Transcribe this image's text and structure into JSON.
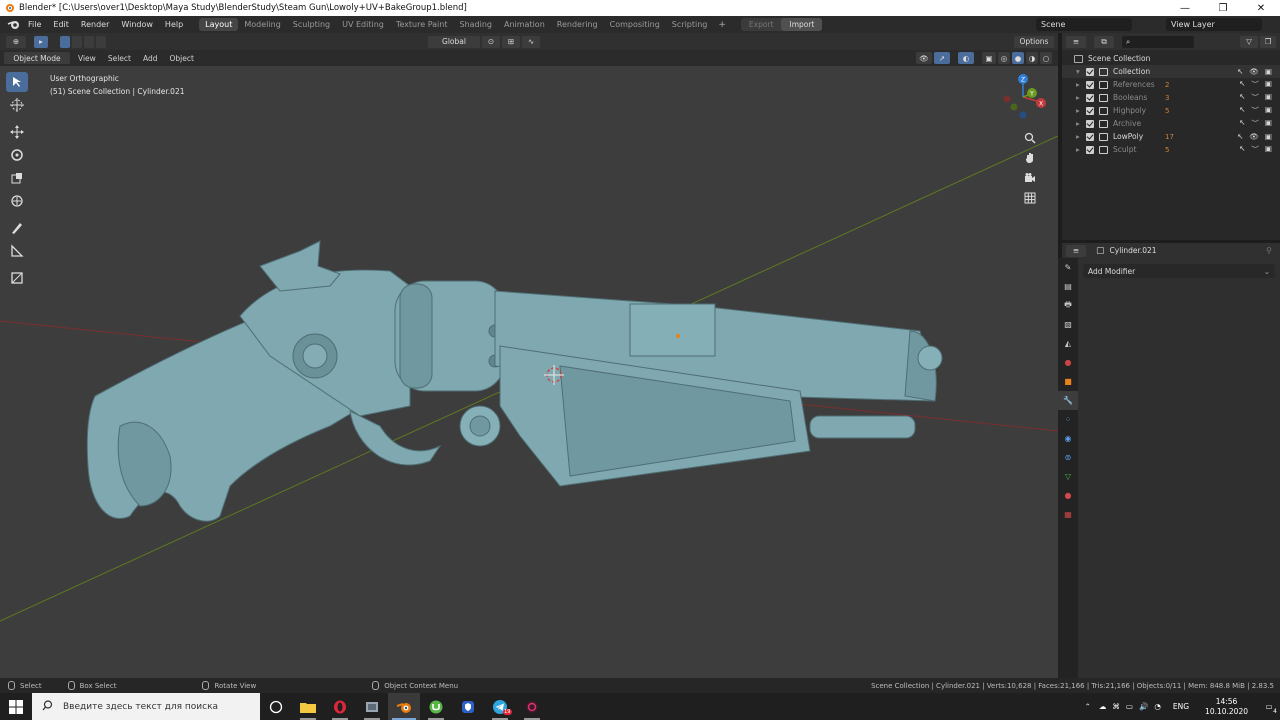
{
  "window": {
    "title": "Blender* [C:\\Users\\over1\\Desktop\\Maya Study\\BlenderStudy\\Steam Gun\\Lowoly+UV+BakeGroup1.blend]",
    "minimize": "—",
    "maximize": "❐",
    "close": "✕"
  },
  "menu": [
    "File",
    "Edit",
    "Render",
    "Window",
    "Help"
  ],
  "workspaces": [
    "Layout",
    "Modeling",
    "Sculpting",
    "UV Editing",
    "Texture Paint",
    "Shading",
    "Animation",
    "Rendering",
    "Compositing",
    "Scripting"
  ],
  "active_workspace": "Layout",
  "add_workspace": "+",
  "export_label": "Export",
  "import_label": "Import",
  "scene": "Scene",
  "view_layer": "View Layer",
  "viewport_header": {
    "transform_orientation": "Global",
    "options": "Options"
  },
  "viewport_menu": {
    "mode": "Object Mode",
    "items": [
      "View",
      "Select",
      "Add",
      "Object"
    ]
  },
  "viewport_info": {
    "view_name": "User Orthographic",
    "context": "(51) Scene Collection | Cylinder.021"
  },
  "gizmo": {
    "x_label": "X",
    "y_label": "Y",
    "z_label": "Z"
  },
  "outliner": {
    "root": "Scene Collection",
    "rows": [
      {
        "label": "Collection",
        "dim": false,
        "badge": ""
      },
      {
        "label": "References",
        "dim": true,
        "badge": "2"
      },
      {
        "label": "Booleans",
        "dim": true,
        "badge": "3"
      },
      {
        "label": "Highpoly",
        "dim": true,
        "badge": "5"
      },
      {
        "label": "Archive",
        "dim": true,
        "badge": ""
      },
      {
        "label": "LowPoly",
        "dim": false,
        "badge": "17"
      },
      {
        "label": "Sculpt",
        "dim": true,
        "badge": "5"
      }
    ]
  },
  "properties": {
    "object_name": "Cylinder.021",
    "add_modifier": "Add Modifier"
  },
  "status": {
    "select": "Select",
    "box_select": "Box Select",
    "rotate_view": "Rotate View",
    "context_menu": "Object Context Menu",
    "stats": "Scene Collection | Cylinder.021 | Verts:10,628 | Faces:21,166 | Tris:21,166 | Objects:0/11 | Mem: 848.8 MiB | 2.83.5"
  },
  "taskbar": {
    "search_placeholder": "Введите здесь текст для поиска",
    "language": "ENG",
    "time": "14:56",
    "date": "10.10.2020",
    "notifications": "4",
    "badge_count": "19"
  },
  "colors": {
    "model": "#7fa8b0",
    "accent": "#4b6d9b",
    "x_axis": "#c23b3b",
    "y_axis": "#6b9a1f",
    "z_axis": "#2f7fd6"
  }
}
